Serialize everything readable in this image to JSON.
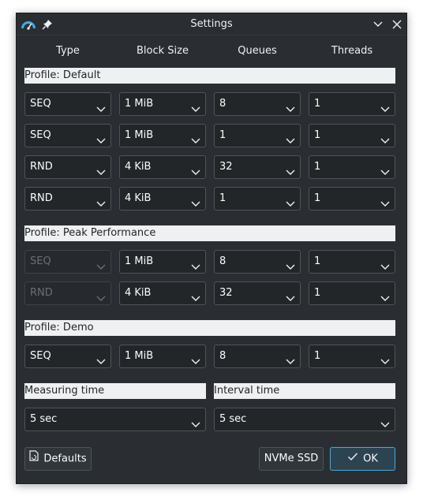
{
  "window": {
    "title": "Settings"
  },
  "columns": [
    "Type",
    "Block Size",
    "Queues",
    "Threads"
  ],
  "profiles": [
    {
      "label": "Profile: Default",
      "rows": [
        {
          "type": "SEQ",
          "block": "1 MiB",
          "queues": "8",
          "threads": "1",
          "type_disabled": false
        },
        {
          "type": "SEQ",
          "block": "1 MiB",
          "queues": "1",
          "threads": "1",
          "type_disabled": false
        },
        {
          "type": "RND",
          "block": "4 KiB",
          "queues": "32",
          "threads": "1",
          "type_disabled": false
        },
        {
          "type": "RND",
          "block": "4 KiB",
          "queues": "1",
          "threads": "1",
          "type_disabled": false
        }
      ]
    },
    {
      "label": "Profile: Peak Performance",
      "rows": [
        {
          "type": "SEQ",
          "block": "1 MiB",
          "queues": "8",
          "threads": "1",
          "type_disabled": true
        },
        {
          "type": "RND",
          "block": "4 KiB",
          "queues": "32",
          "threads": "1",
          "type_disabled": true
        }
      ]
    },
    {
      "label": "Profile: Demo",
      "rows": [
        {
          "type": "SEQ",
          "block": "1 MiB",
          "queues": "8",
          "threads": "1",
          "type_disabled": false
        }
      ]
    }
  ],
  "measuring": {
    "label": "Measuring time",
    "value": "5 sec"
  },
  "interval": {
    "label": "Interval time",
    "value": "5 sec"
  },
  "buttons": {
    "defaults": "Defaults",
    "nvme": "NVMe SSD",
    "ok": "OK"
  },
  "colors": {
    "accent": "#3daee9",
    "background": "#2a2e32",
    "field": "#232629",
    "section": "#eff0f1"
  }
}
